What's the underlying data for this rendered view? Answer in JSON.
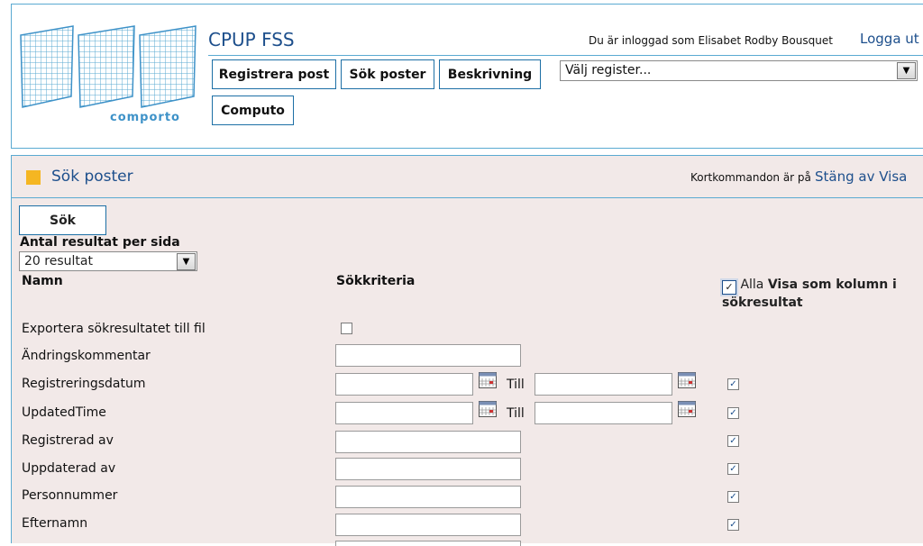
{
  "header": {
    "logo_text": "comporto",
    "app_title": "CPUP FSS",
    "login_info": "Du är inloggad som Elisabet Rodby Bousquet",
    "logout": "Logga ut",
    "nav": {
      "register_post": "Registrera post",
      "search_posts": "Sök poster",
      "description": "Beskrivning",
      "computo": "Computo"
    },
    "register_select": {
      "value": "Välj register..."
    }
  },
  "section": {
    "title": "Sök poster",
    "shortcut_text": "Kortkommandon är på",
    "shortcut_links": "Stäng av Visa"
  },
  "search": {
    "button": "Sök",
    "per_page_label": "Antal resultat per sida",
    "per_page_value": "20 resultat",
    "col_name": "Namn",
    "col_criteria": "Sökkriteria",
    "alla_label": "Alla",
    "show_column_label": "Visa som kolumn i sökresultat",
    "till": "Till",
    "rows": [
      {
        "label": "Exportera sökresultatet till fil",
        "type": "checkbox",
        "column_checked": null
      },
      {
        "label": "Ändringskommentar",
        "type": "text",
        "column_checked": null
      },
      {
        "label": "Registreringsdatum",
        "type": "daterange",
        "column_checked": true
      },
      {
        "label": "UpdatedTime",
        "type": "daterange",
        "column_checked": true
      },
      {
        "label": "Registrerad av",
        "type": "text",
        "column_checked": true
      },
      {
        "label": "Uppdaterad av",
        "type": "text",
        "column_checked": true
      },
      {
        "label": "Personnummer",
        "type": "text",
        "column_checked": true
      },
      {
        "label": "Efternamn",
        "type": "text",
        "column_checked": true
      }
    ]
  },
  "colors": {
    "accent": "#1d4f8c",
    "border": "#5aaad2",
    "panel_bg": "#f2e9e8",
    "marker": "#f5b622"
  }
}
